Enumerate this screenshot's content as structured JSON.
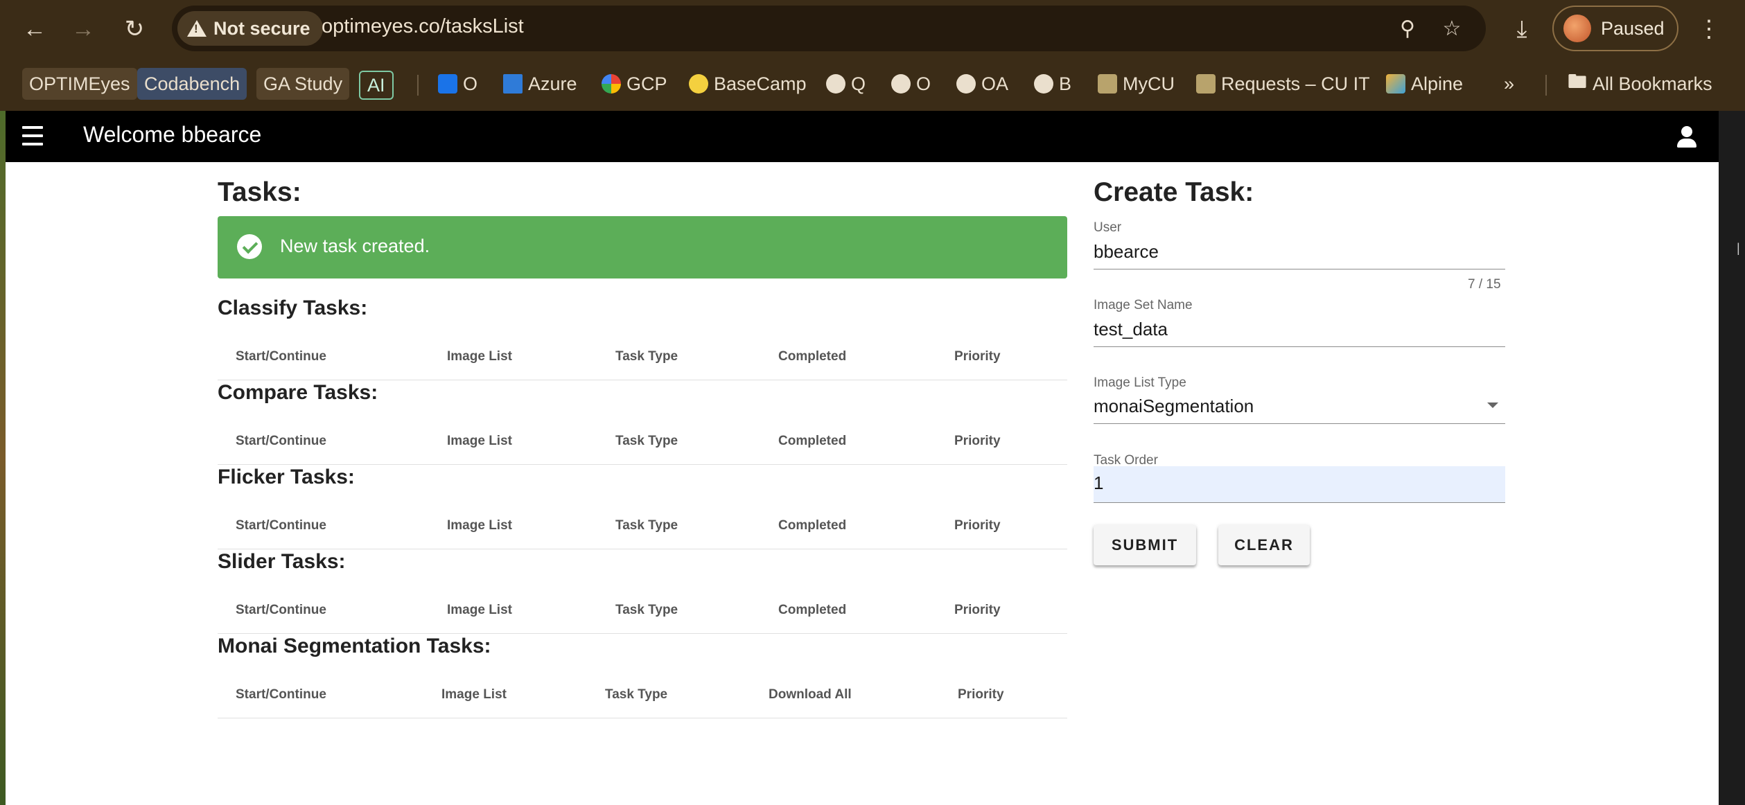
{
  "browser": {
    "security_label": "Not secure",
    "url": "optimeyes.co/tasksList",
    "profile_label": "Paused",
    "bookmarks": [
      {
        "label": "OPTIMEyes"
      },
      {
        "label": "Codabench"
      },
      {
        "label": "GA Study"
      },
      {
        "label": "AI"
      },
      {
        "label": "O"
      },
      {
        "label": "Azure"
      },
      {
        "label": "GCP"
      },
      {
        "label": "BaseCamp"
      },
      {
        "label": "Q"
      },
      {
        "label": "O"
      },
      {
        "label": "OA"
      },
      {
        "label": "B"
      },
      {
        "label": "MyCU"
      },
      {
        "label": "Requests – CU IT"
      },
      {
        "label": "Alpine"
      }
    ],
    "overflow_label": "»",
    "all_bookmarks_label": "All Bookmarks"
  },
  "app": {
    "welcome": "Welcome bbearce"
  },
  "tasks": {
    "title": "Tasks:",
    "snackbar": "New task created.",
    "sections": [
      {
        "title": "Classify Tasks:",
        "columns": [
          "Start/Continue",
          "Image List",
          "Task Type",
          "Completed",
          "Priority"
        ]
      },
      {
        "title": "Compare Tasks:",
        "columns": [
          "Start/Continue",
          "Image List",
          "Task Type",
          "Completed",
          "Priority"
        ]
      },
      {
        "title": "Flicker Tasks:",
        "columns": [
          "Start/Continue",
          "Image List",
          "Task Type",
          "Completed",
          "Priority"
        ]
      },
      {
        "title": "Slider Tasks:",
        "columns": [
          "Start/Continue",
          "Image List",
          "Task Type",
          "Completed",
          "Priority"
        ]
      },
      {
        "title": "Monai Segmentation Tasks:",
        "columns": [
          "Start/Continue",
          "Image List",
          "Task Type",
          "Download All",
          "Priority"
        ]
      }
    ]
  },
  "create_task": {
    "title": "Create Task:",
    "user": {
      "label": "User",
      "value": "bbearce",
      "counter": "7 / 15"
    },
    "image_set_name": {
      "label": "Image Set Name",
      "value": "test_data"
    },
    "image_list_type": {
      "label": "Image List Type",
      "value": "monaiSegmentation"
    },
    "task_order": {
      "label": "Task Order",
      "value": "1"
    },
    "submit_label": "SUBMIT",
    "clear_label": "CLEAR"
  },
  "colors": {
    "success": "#5cae58",
    "app_bar": "#000000",
    "autofill": "#e8f0fe"
  }
}
